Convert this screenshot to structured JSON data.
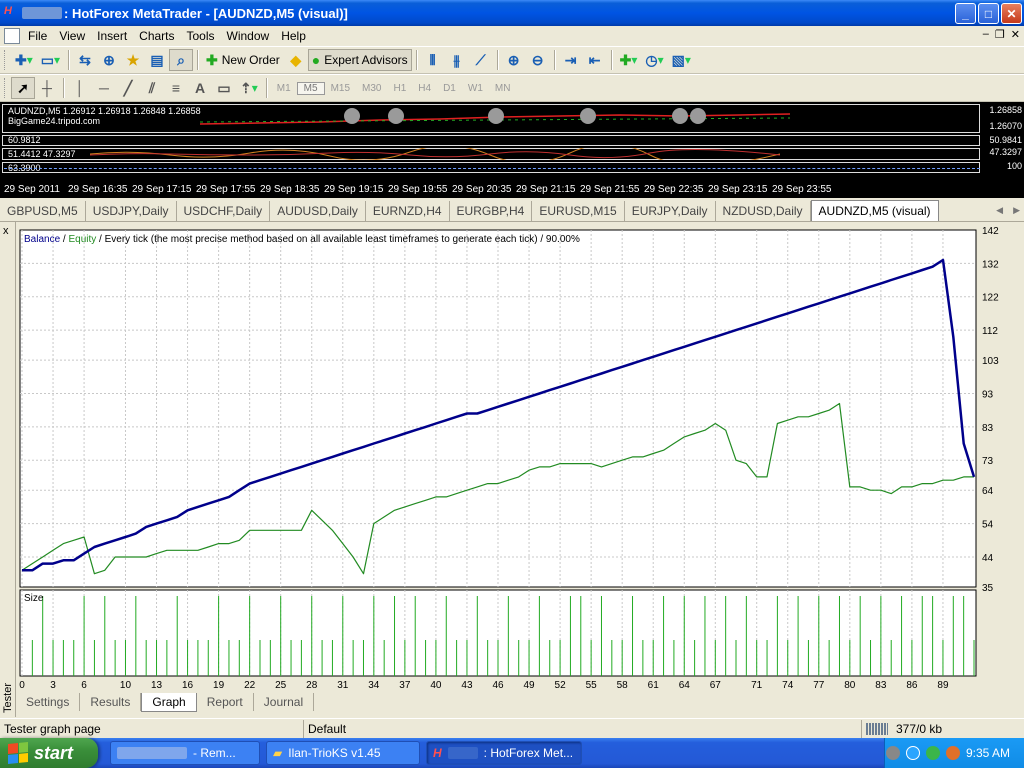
{
  "window": {
    "title": ": HotForex MetaTrader - [AUDNZD,M5 (visual)]",
    "icon_glyph": "H"
  },
  "menu": [
    "File",
    "View",
    "Insert",
    "Charts",
    "Tools",
    "Window",
    "Help"
  ],
  "toolbar": {
    "new_order": "New Order",
    "expert_advisors": "Expert Advisors"
  },
  "timeframes": [
    "M1",
    "M5",
    "M15",
    "M30",
    "H1",
    "H4",
    "D1",
    "W1",
    "MN"
  ],
  "active_timeframe": "M5",
  "chart_strip": {
    "header": "AUDNZD,M5  1.26912 1.26918 1.26848 1.26858",
    "watermark": "BigGame24.tripod.com",
    "price_top": "1.26858",
    "price_mid": "1.26070",
    "ind1_label": "60.9812",
    "ind2_label": "51.4412 47.3297",
    "ind3_label": "63.3900",
    "ind_right1": "50.9841",
    "ind_right2": "47.3297",
    "ind_right3": "100",
    "times": [
      "29 Sep 2011",
      "29 Sep 16:35",
      "29 Sep 17:15",
      "29 Sep 17:55",
      "29 Sep 18:35",
      "29 Sep 19:15",
      "29 Sep 19:55",
      "29 Sep 20:35",
      "29 Sep 21:15",
      "29 Sep 21:55",
      "29 Sep 22:35",
      "29 Sep 23:15",
      "29 Sep 23:55"
    ]
  },
  "chart_tabs": [
    "GBPUSD,M5",
    "USDJPY,Daily",
    "USDCHF,Daily",
    "AUDUSD,Daily",
    "EURNZD,H4",
    "EURGBP,H4",
    "EURUSD,M15",
    "EURJPY,Daily",
    "NZDUSD,Daily",
    "AUDNZD,M5 (visual)"
  ],
  "active_chart_tab": "AUDNZD,M5 (visual)",
  "tester": {
    "side_label": "Tester",
    "close_glyph": "x",
    "legend": {
      "balance": "Balance",
      "slash1": " / ",
      "equity": "Equity",
      "rest": " / Every tick (the most precise method based on all available least timeframes to generate each tick) / 90.00%"
    },
    "size_label": "Size",
    "tabs": [
      "Settings",
      "Results",
      "Graph",
      "Report",
      "Journal"
    ],
    "active_tab": "Graph"
  },
  "chart_data": {
    "type": "line",
    "x_ticks": [
      0,
      3,
      6,
      10,
      13,
      16,
      19,
      22,
      25,
      28,
      31,
      34,
      37,
      40,
      43,
      46,
      49,
      52,
      55,
      58,
      61,
      64,
      67,
      71,
      74,
      77,
      80,
      83,
      86,
      89
    ],
    "x_range": [
      0,
      92
    ],
    "y_ticks": [
      35,
      44,
      54,
      64,
      73,
      83,
      93,
      103,
      112,
      122,
      132,
      142
    ],
    "ylim": [
      35,
      142
    ],
    "grid": true,
    "series": [
      {
        "name": "Balance",
        "color": "#00008b",
        "x": [
          0,
          1,
          2,
          3,
          4,
          5,
          6,
          7,
          8,
          9,
          10,
          11,
          12,
          13,
          14,
          15,
          16,
          17,
          18,
          19,
          20,
          21,
          22,
          23,
          24,
          25,
          26,
          27,
          28,
          29,
          30,
          31,
          32,
          33,
          34,
          35,
          36,
          37,
          38,
          39,
          40,
          41,
          42,
          43,
          44,
          45,
          46,
          47,
          48,
          49,
          50,
          51,
          52,
          53,
          54,
          55,
          56,
          57,
          58,
          59,
          60,
          61,
          62,
          63,
          64,
          65,
          66,
          67,
          68,
          69,
          70,
          71,
          72,
          73,
          74,
          75,
          76,
          77,
          78,
          79,
          80,
          81,
          82,
          83,
          84,
          85,
          86,
          87,
          88,
          89,
          90,
          91,
          92
        ],
        "y": [
          40,
          40,
          42,
          42,
          43,
          43,
          45,
          47,
          48,
          49,
          50,
          51,
          53,
          54,
          55,
          56,
          58,
          59,
          60,
          61,
          62,
          64,
          66,
          67,
          68,
          69,
          70,
          71,
          72,
          73,
          74,
          75,
          76,
          77,
          78,
          79,
          80,
          81,
          82,
          83,
          84,
          85,
          86,
          87,
          87,
          88,
          89,
          90,
          91,
          92,
          93,
          94,
          95,
          96,
          97,
          98,
          99,
          100,
          101,
          102,
          103,
          104,
          105,
          106,
          107,
          108,
          109,
          110,
          111,
          112,
          113,
          114,
          115,
          116,
          117,
          118,
          119,
          120,
          121,
          122,
          123,
          124,
          125,
          126,
          127,
          128,
          129,
          130,
          131,
          133,
          110,
          78,
          68
        ]
      },
      {
        "name": "Equity",
        "color": "#228b22",
        "x": [
          0,
          1,
          2,
          3,
          4,
          5,
          6,
          7,
          8,
          9,
          10,
          11,
          12,
          13,
          14,
          15,
          16,
          17,
          18,
          19,
          20,
          21,
          22,
          23,
          24,
          25,
          26,
          27,
          28,
          29,
          30,
          31,
          32,
          33,
          34,
          35,
          36,
          37,
          38,
          39,
          40,
          41,
          42,
          43,
          44,
          45,
          46,
          47,
          48,
          49,
          50,
          51,
          52,
          53,
          54,
          55,
          56,
          57,
          58,
          59,
          60,
          61,
          62,
          63,
          64,
          65,
          66,
          67,
          68,
          69,
          70,
          71,
          72,
          73,
          74,
          75,
          76,
          77,
          78,
          79,
          80,
          81,
          82,
          83,
          84,
          85,
          86,
          87,
          88,
          89,
          90,
          91,
          92
        ],
        "y": [
          40,
          42,
          44,
          46,
          48,
          49,
          50,
          39,
          40,
          44,
          44,
          44,
          44,
          45,
          46,
          46,
          46,
          46,
          47,
          48,
          48,
          49,
          52,
          52,
          52,
          52,
          52,
          52,
          58,
          55,
          52,
          48,
          44,
          39,
          54,
          56,
          58,
          59,
          60,
          61,
          62,
          62,
          63,
          64,
          65,
          66,
          66,
          67,
          68,
          70,
          71,
          71,
          72,
          72,
          72,
          72,
          71,
          72,
          73,
          74,
          74,
          75,
          76,
          78,
          80,
          81,
          82,
          84,
          82,
          73,
          72,
          68,
          68,
          84,
          85,
          86,
          86,
          87,
          88,
          90,
          65,
          65,
          64,
          64,
          63,
          65,
          65,
          66,
          66,
          67,
          67,
          68,
          68
        ]
      }
    ],
    "size_bars": [
      {
        "x": 1,
        "h": 0.45
      },
      {
        "x": 2,
        "h": 1
      },
      {
        "x": 3,
        "h": 0.45
      },
      {
        "x": 4,
        "h": 0.45
      },
      {
        "x": 5,
        "h": 0.45
      },
      {
        "x": 6,
        "h": 1
      },
      {
        "x": 7,
        "h": 0.45
      },
      {
        "x": 8,
        "h": 1
      },
      {
        "x": 9,
        "h": 0.45
      },
      {
        "x": 10,
        "h": 0.45
      },
      {
        "x": 11,
        "h": 1
      },
      {
        "x": 12,
        "h": 0.45
      },
      {
        "x": 13,
        "h": 0.45
      },
      {
        "x": 14,
        "h": 0.45
      },
      {
        "x": 15,
        "h": 1
      },
      {
        "x": 16,
        "h": 0.45
      },
      {
        "x": 17,
        "h": 0.45
      },
      {
        "x": 18,
        "h": 0.45
      },
      {
        "x": 19,
        "h": 1
      },
      {
        "x": 20,
        "h": 0.45
      },
      {
        "x": 21,
        "h": 0.45
      },
      {
        "x": 22,
        "h": 1
      },
      {
        "x": 23,
        "h": 0.45
      },
      {
        "x": 24,
        "h": 0.45
      },
      {
        "x": 25,
        "h": 1
      },
      {
        "x": 26,
        "h": 0.45
      },
      {
        "x": 27,
        "h": 0.45
      },
      {
        "x": 28,
        "h": 1
      },
      {
        "x": 29,
        "h": 0.45
      },
      {
        "x": 30,
        "h": 0.45
      },
      {
        "x": 31,
        "h": 1
      },
      {
        "x": 32,
        "h": 0.45
      },
      {
        "x": 33,
        "h": 0.45
      },
      {
        "x": 34,
        "h": 1
      },
      {
        "x": 35,
        "h": 0.45
      },
      {
        "x": 36,
        "h": 1
      },
      {
        "x": 37,
        "h": 0.45
      },
      {
        "x": 38,
        "h": 1
      },
      {
        "x": 39,
        "h": 0.45
      },
      {
        "x": 40,
        "h": 0.45
      },
      {
        "x": 41,
        "h": 1
      },
      {
        "x": 42,
        "h": 0.45
      },
      {
        "x": 43,
        "h": 0.45
      },
      {
        "x": 44,
        "h": 1
      },
      {
        "x": 45,
        "h": 0.45
      },
      {
        "x": 46,
        "h": 0.45
      },
      {
        "x": 47,
        "h": 1
      },
      {
        "x": 48,
        "h": 0.45
      },
      {
        "x": 49,
        "h": 0.45
      },
      {
        "x": 50,
        "h": 1
      },
      {
        "x": 51,
        "h": 0.45
      },
      {
        "x": 52,
        "h": 0.45
      },
      {
        "x": 53,
        "h": 1
      },
      {
        "x": 54,
        "h": 1
      },
      {
        "x": 55,
        "h": 0.45
      },
      {
        "x": 56,
        "h": 1
      },
      {
        "x": 57,
        "h": 0.45
      },
      {
        "x": 58,
        "h": 0.45
      },
      {
        "x": 59,
        "h": 1
      },
      {
        "x": 60,
        "h": 0.45
      },
      {
        "x": 61,
        "h": 0.45
      },
      {
        "x": 62,
        "h": 1
      },
      {
        "x": 63,
        "h": 0.45
      },
      {
        "x": 64,
        "h": 1
      },
      {
        "x": 65,
        "h": 0.45
      },
      {
        "x": 66,
        "h": 1
      },
      {
        "x": 67,
        "h": 0.45
      },
      {
        "x": 68,
        "h": 1
      },
      {
        "x": 69,
        "h": 0.45
      },
      {
        "x": 70,
        "h": 1
      },
      {
        "x": 71,
        "h": 0.45
      },
      {
        "x": 72,
        "h": 0.45
      },
      {
        "x": 73,
        "h": 1
      },
      {
        "x": 74,
        "h": 0.45
      },
      {
        "x": 75,
        "h": 1
      },
      {
        "x": 76,
        "h": 0.45
      },
      {
        "x": 77,
        "h": 1
      },
      {
        "x": 78,
        "h": 0.45
      },
      {
        "x": 79,
        "h": 1
      },
      {
        "x": 80,
        "h": 0.45
      },
      {
        "x": 81,
        "h": 1
      },
      {
        "x": 82,
        "h": 0.45
      },
      {
        "x": 83,
        "h": 1
      },
      {
        "x": 84,
        "h": 0.45
      },
      {
        "x": 85,
        "h": 1
      },
      {
        "x": 86,
        "h": 0.45
      },
      {
        "x": 87,
        "h": 1
      },
      {
        "x": 88,
        "h": 1
      },
      {
        "x": 89,
        "h": 0.45
      },
      {
        "x": 90,
        "h": 1
      },
      {
        "x": 91,
        "h": 1
      },
      {
        "x": 92,
        "h": 0.45
      }
    ]
  },
  "statusbar": {
    "left": "Tester graph page",
    "profile": "Default",
    "traffic": "377/0 kb"
  },
  "taskbar": {
    "start": "start",
    "tasks": [
      {
        "label": "- Rem...",
        "active": false
      },
      {
        "label": "Ilan-TrioKS v1.45",
        "active": false
      },
      {
        "label": ": HotForex Met...",
        "active": true
      }
    ],
    "clock": "9:35 AM"
  },
  "colors": {
    "balance": "#00008b",
    "equity": "#228b22",
    "size_bars": "#22aa22",
    "xp_blue": "#0054e3"
  }
}
